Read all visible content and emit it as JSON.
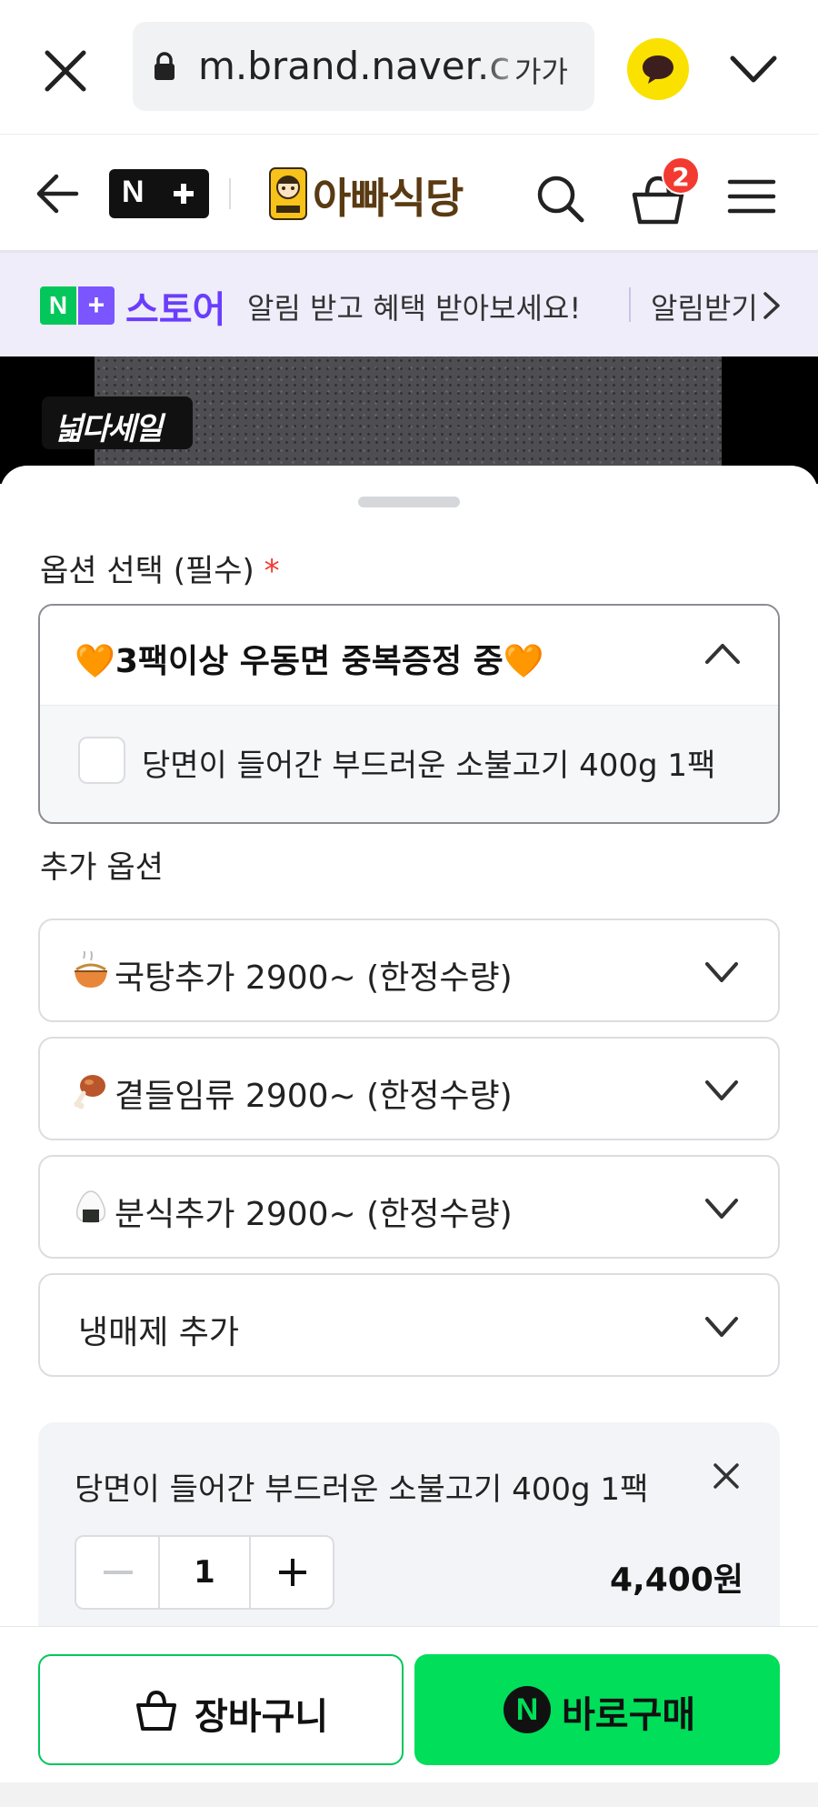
{
  "browser": {
    "url": "m.brand.naver.c",
    "reader_label": "가가"
  },
  "header": {
    "logo_text": "N+",
    "brand_name": "아빠식당",
    "cart_count": "2"
  },
  "store_banner": {
    "logo_n": "N",
    "logo_plus": "+",
    "store_word": "스토어",
    "message": "알림 받고 혜택 받아보세요!",
    "action": "알림받기"
  },
  "product": {
    "sale_badge": "넓다세일"
  },
  "options": {
    "required_title": "옵션 선택 (필수)",
    "required_mark": "*",
    "required_dropdown": {
      "label": "🧡3팩이상 우동면 중복증정 중🧡",
      "items": [
        {
          "label": "당면이 들어간 부드러운 소불고기 400g 1팩",
          "checked": false
        }
      ]
    },
    "additional_title": "추가 옵션",
    "additional": [
      {
        "emoji": "soup-bowl-icon",
        "label": "국탕추가 2900~ (한정수량)"
      },
      {
        "emoji": "chicken-leg-icon",
        "label": "곁들임류 2900~ (한정수량)"
      },
      {
        "emoji": "rice-ball-icon",
        "label": "분식추가 2900~ (한정수량)"
      },
      {
        "emoji": "",
        "label": "냉매제 추가"
      }
    ]
  },
  "selected": {
    "name": "당면이 들어간 부드러운 소불고기 400g 1팩",
    "quantity": "1",
    "price": "4,400원"
  },
  "actions": {
    "cart_label": "장바구니",
    "buy_icon": "N",
    "buy_label": "바로구매"
  },
  "colors": {
    "naver_green": "#03c75a",
    "buy_green": "#00de5a",
    "store_purple": "#6a3dfc",
    "badge_red": "#f33a30",
    "kakao_yellow": "#fae100"
  }
}
